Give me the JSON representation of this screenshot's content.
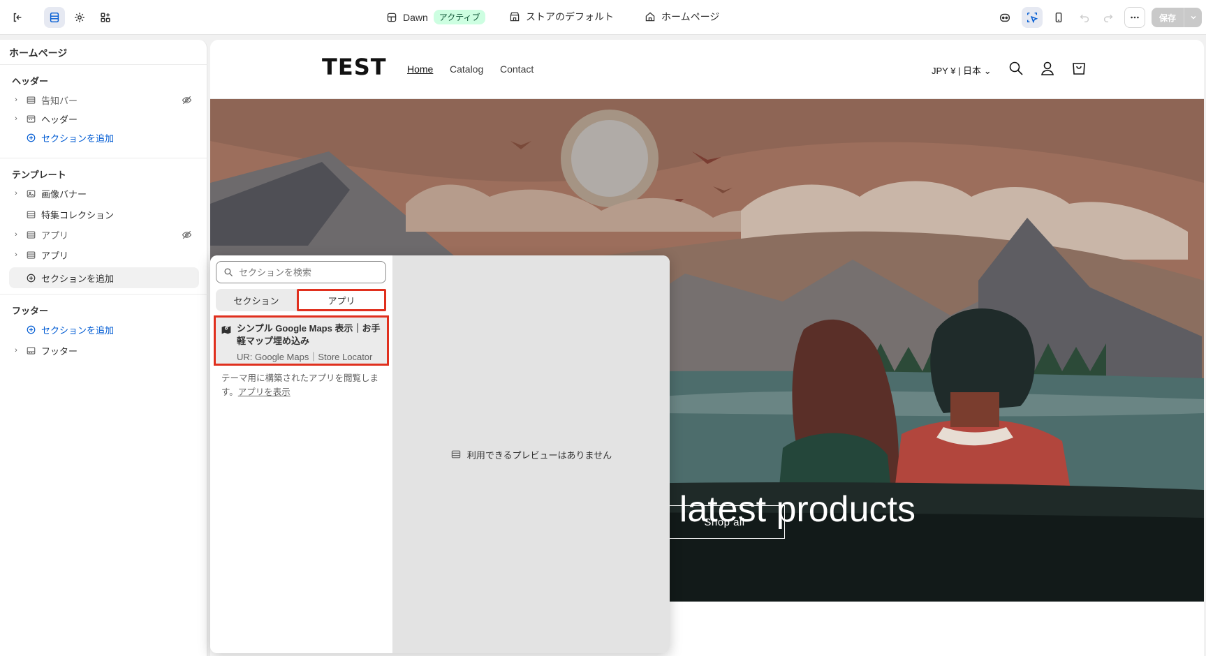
{
  "topbar": {
    "theme_name": "Dawn",
    "theme_badge": "アクティブ",
    "store_default": "ストアのデフォルト",
    "page_selector": "ホームページ",
    "save_label": "保存"
  },
  "sidebar": {
    "title": "ホームページ",
    "header_group": "ヘッダー",
    "header_items": [
      {
        "label": "告知バー",
        "hidden": true
      },
      {
        "label": "ヘッダー",
        "hidden": false
      }
    ],
    "header_add": "セクションを追加",
    "template_group": "テンプレート",
    "template_items": [
      {
        "label": "画像バナー"
      },
      {
        "label": "特集コレクション"
      },
      {
        "label": "アプリ",
        "hidden": true
      },
      {
        "label": "アプリ"
      }
    ],
    "template_add": "セクションを追加",
    "footer_group": "フッター",
    "footer_add": "セクションを追加",
    "footer_items": [
      {
        "label": "フッター"
      }
    ]
  },
  "store": {
    "logo": "TEST",
    "nav": [
      "Home",
      "Catalog",
      "Contact"
    ],
    "currency": "JPY ¥ | 日本",
    "hero_text": "r latest products",
    "hero_button": "Shop all"
  },
  "picker": {
    "search_placeholder": "セクションを検索",
    "tab_sections": "セクション",
    "tab_apps": "アプリ",
    "app_title": "シンプル Google Maps 表示｜お手軽マップ埋め込み",
    "app_subtitle": "UR: Google Maps｜Store Locator",
    "note_text": "テーマ用に構築されたアプリを閲覧します。",
    "note_link": "アプリを表示",
    "preview_empty": "利用できるプレビューはありません"
  },
  "colors": {
    "accent_blue": "#005bd3",
    "highlight_red": "#e0301e",
    "badge_green": "#cdfee1"
  }
}
